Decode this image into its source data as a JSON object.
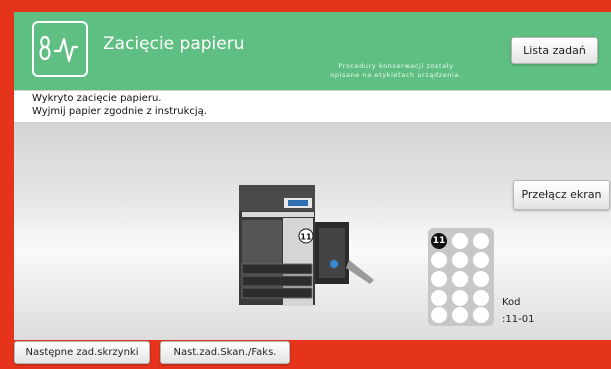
{
  "header": {
    "title": "Zacięcie papieru",
    "note_line1": "Procedury konserwacji zostały",
    "note_line2": "opisane na etykietach urządzenia.",
    "jobs_button": "Lista zadań",
    "icon": "paper-jam-icon"
  },
  "message": {
    "line1": "Wykryto zacięcie papieru.",
    "line2": "Wyjmij papier zgodnie z instrukcją."
  },
  "content": {
    "switch_button": "Przełącz ekran",
    "jam_marker": "11",
    "code_label": "Kod",
    "code_value": ":11-01"
  },
  "footer": {
    "next_box_button": "Następne zad.skrzynki",
    "next_scan_button": "Nast.zad.Skan./Faks."
  },
  "colors": {
    "frame": "#e5341b",
    "header": "#5fbf82",
    "active_key": "#111111"
  }
}
